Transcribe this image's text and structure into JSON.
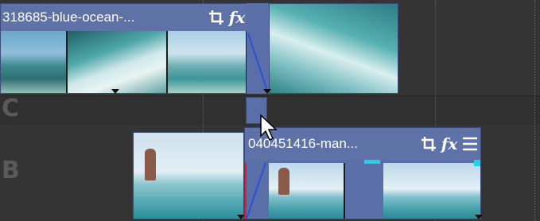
{
  "timeline": {
    "track_labels": [
      "",
      "C",
      "B"
    ]
  },
  "event_top": {
    "name": "318685-blue-ocean-...",
    "crop_icon": "crop-icon",
    "fx_label": "fx",
    "menu_icon": "menu-icon"
  },
  "event_bottom": {
    "name": "040451416-man...",
    "crop_icon": "crop-icon",
    "fx_label": "fx",
    "menu_icon": "menu-icon"
  },
  "colors": {
    "event_header": "#5e72a8",
    "event_body": "#5a6fa8",
    "fade_line": "#2f4fd8",
    "edge_red": "#e0201e",
    "edge_cyan": "#23d0e6"
  }
}
